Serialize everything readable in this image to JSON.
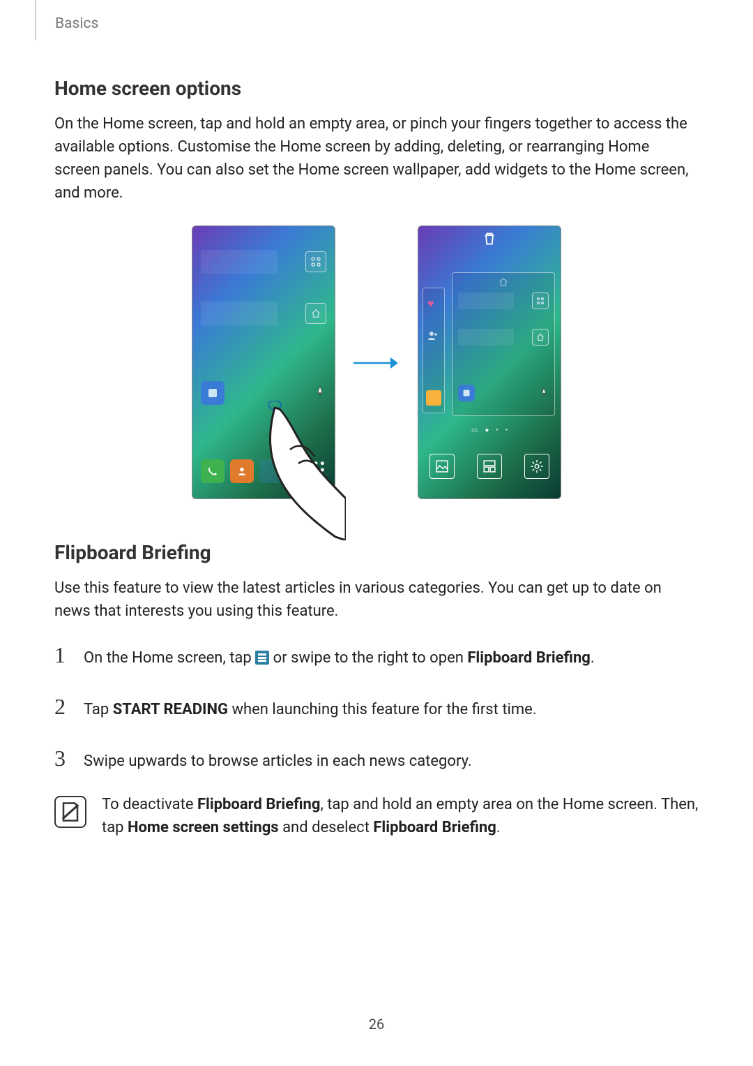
{
  "header": {
    "section": "Basics"
  },
  "section1": {
    "title": "Home screen options",
    "body": "On the Home screen, tap and hold an empty area, or pinch your fingers together to access the available options. Customise the Home screen by adding, deleting, or rearranging Home screen panels. You can also set the Home screen wallpaper, add widgets to the Home screen, and more."
  },
  "section2": {
    "title": "Flipboard Briefing",
    "body": "Use this feature to view the latest articles in various categories. You can get up to date on news that interests you using this feature.",
    "steps": {
      "s1_a": "On the Home screen, tap ",
      "s1_b": " or swipe to the right to open ",
      "s1_c": "Flipboard Briefing",
      "s1_d": ".",
      "s2_a": "Tap ",
      "s2_b": "START READING",
      "s2_c": " when launching this feature for the first time.",
      "s3": "Swipe upwards to browse articles in each news category."
    },
    "note": {
      "a": "To deactivate ",
      "b": "Flipboard Briefing",
      "c": ", tap and hold an empty area on the Home screen. Then, tap ",
      "d": "Home screen settings",
      "e": " and deselect ",
      "f": "Flipboard Briefing",
      "g": "."
    }
  },
  "page_number": "26",
  "figure": {
    "phone1_icons": [
      "apps",
      "home"
    ],
    "phone2_bottom": [
      "wallpaper",
      "widgets",
      "settings"
    ]
  }
}
